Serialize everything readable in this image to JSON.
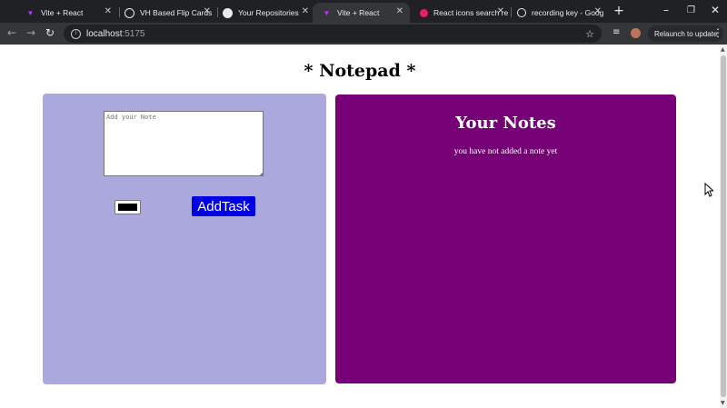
{
  "browser": {
    "tabs": [
      {
        "title": "Vite + React",
        "icon": "vite-icon",
        "active": false
      },
      {
        "title": "VH Based Flip Cards",
        "icon": "globe-icon",
        "active": false
      },
      {
        "title": "Your Repositories",
        "icon": "github-icon",
        "active": false
      },
      {
        "title": "Vite + React",
        "icon": "vite-icon",
        "active": true
      },
      {
        "title": "React icons search re",
        "icon": "react-icons-icon",
        "active": false
      },
      {
        "title": "recording key - Goog",
        "icon": "google-icon",
        "active": false
      }
    ],
    "url_host": "localhost",
    "url_port": ":5175",
    "relaunch_label": "Relaunch to update"
  },
  "page": {
    "title": "* Notepad *",
    "note_placeholder": "Add your Note",
    "note_value": "",
    "color_value": "#000000",
    "add_button_label": "AddTask",
    "notes_heading": "Your Notes",
    "empty_message": "you have not added a note yet"
  },
  "colors": {
    "left_panel": "#aaa8dc",
    "right_panel": "#760076",
    "add_button": "#0000e6"
  }
}
